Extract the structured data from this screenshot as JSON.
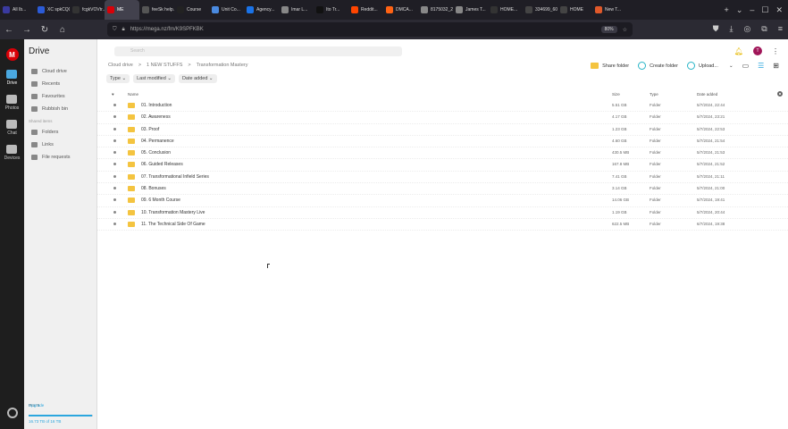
{
  "browser": {
    "tabs": [
      {
        "label": "All Ib...",
        "color": "#3a3aa0"
      },
      {
        "label": "XC spkCQ0U...",
        "color": "#2b5bd7"
      },
      {
        "label": "fcgkVOVtr...",
        "color": "#333"
      },
      {
        "label": "ME",
        "color": "#d90007",
        "active": true
      },
      {
        "label": "feeSk help...",
        "color": "#555"
      },
      {
        "label": "Course",
        "color": "#222"
      },
      {
        "label": "Unit Co...",
        "color": "#4a8ae0"
      },
      {
        "label": "Agency...",
        "color": "#1a73e8"
      },
      {
        "label": "Imar L...",
        "color": "#888"
      },
      {
        "label": "Ito Tr...",
        "color": "#111"
      },
      {
        "label": "Reddit...",
        "color": "#ff4500"
      },
      {
        "label": "DMCA...",
        "color": "#ff6314"
      },
      {
        "label": "8175032_21...",
        "color": "#888"
      },
      {
        "label": "James T...",
        "color": "#888"
      },
      {
        "label": "HOME...",
        "color": "#333"
      },
      {
        "label": "334699_60...",
        "color": "#444"
      },
      {
        "label": "HOME",
        "color": "#444"
      },
      {
        "label": "New T...",
        "color": "#e0592a"
      }
    ],
    "url": "https://mega.nz/fm/K9SPFKBK",
    "zoom": "80%"
  },
  "rail": [
    {
      "label": "Drive",
      "active": true
    },
    {
      "label": "Photos"
    },
    {
      "label": "Chat"
    },
    {
      "label": "Devices"
    }
  ],
  "sidebar": {
    "title": "Drive",
    "items": [
      "Cloud drive",
      "Recents",
      "Favourites",
      "Rubbish bin"
    ],
    "shared_header": "Shared items",
    "shared_items": [
      "Folders",
      "Links",
      "File requests"
    ],
    "plan": "Pro III",
    "upgrade": "Upgrade",
    "storage_text": "16.73 TB of 16 TB",
    "storage_fraction": 0.99
  },
  "main": {
    "search_placeholder": "Search",
    "breadcrumbs": [
      "Cloud drive",
      ">",
      "1 NEW STUFFS",
      ">",
      "Transformation Mastery"
    ],
    "actions": [
      "Share folder",
      "Create folder",
      "Upload..."
    ],
    "filters": [
      "Type",
      "Last modified",
      "Date added"
    ],
    "columns": {
      "name": "Name",
      "size": "Size",
      "type": "Type",
      "date": "Date added"
    },
    "rows": [
      {
        "name": "01. Introduction",
        "size": "5.51 GB",
        "type": "Folder",
        "date": "5/7/2024, 22:44"
      },
      {
        "name": "02. Awareness",
        "size": "4.17 GB",
        "type": "Folder",
        "date": "5/7/2024, 23:21"
      },
      {
        "name": "03. Proof",
        "size": "1.23 GB",
        "type": "Folder",
        "date": "5/7/2024, 22:53"
      },
      {
        "name": "04. Permanence",
        "size": "4.60 GB",
        "type": "Folder",
        "date": "5/7/2024, 21:54"
      },
      {
        "name": "05. Conclusion",
        "size": "430.5 MB",
        "type": "Folder",
        "date": "5/7/2024, 21:53"
      },
      {
        "name": "06. Guided Releases",
        "size": "167.8 MB",
        "type": "Folder",
        "date": "5/7/2024, 21:52"
      },
      {
        "name": "07. Transformational Infield Series",
        "size": "7.41 GB",
        "type": "Folder",
        "date": "5/7/2024, 21:11"
      },
      {
        "name": "08. Bonuses",
        "size": "3.14 GB",
        "type": "Folder",
        "date": "5/7/2024, 21:00"
      },
      {
        "name": "09. 6 Month Course",
        "size": "14.06 GB",
        "type": "Folder",
        "date": "5/7/2024, 19:41"
      },
      {
        "name": "10. Transformation Mastery Live",
        "size": "1.19 GB",
        "type": "Folder",
        "date": "5/7/2024, 20:44"
      },
      {
        "name": "11. The Technical Side Of Game",
        "size": "622.5 MB",
        "type": "Folder",
        "date": "6/7/2024, 19:38"
      }
    ]
  },
  "colors": {
    "accent": "#d90007",
    "folder": "#f4c440",
    "link": "#2ba6de"
  }
}
